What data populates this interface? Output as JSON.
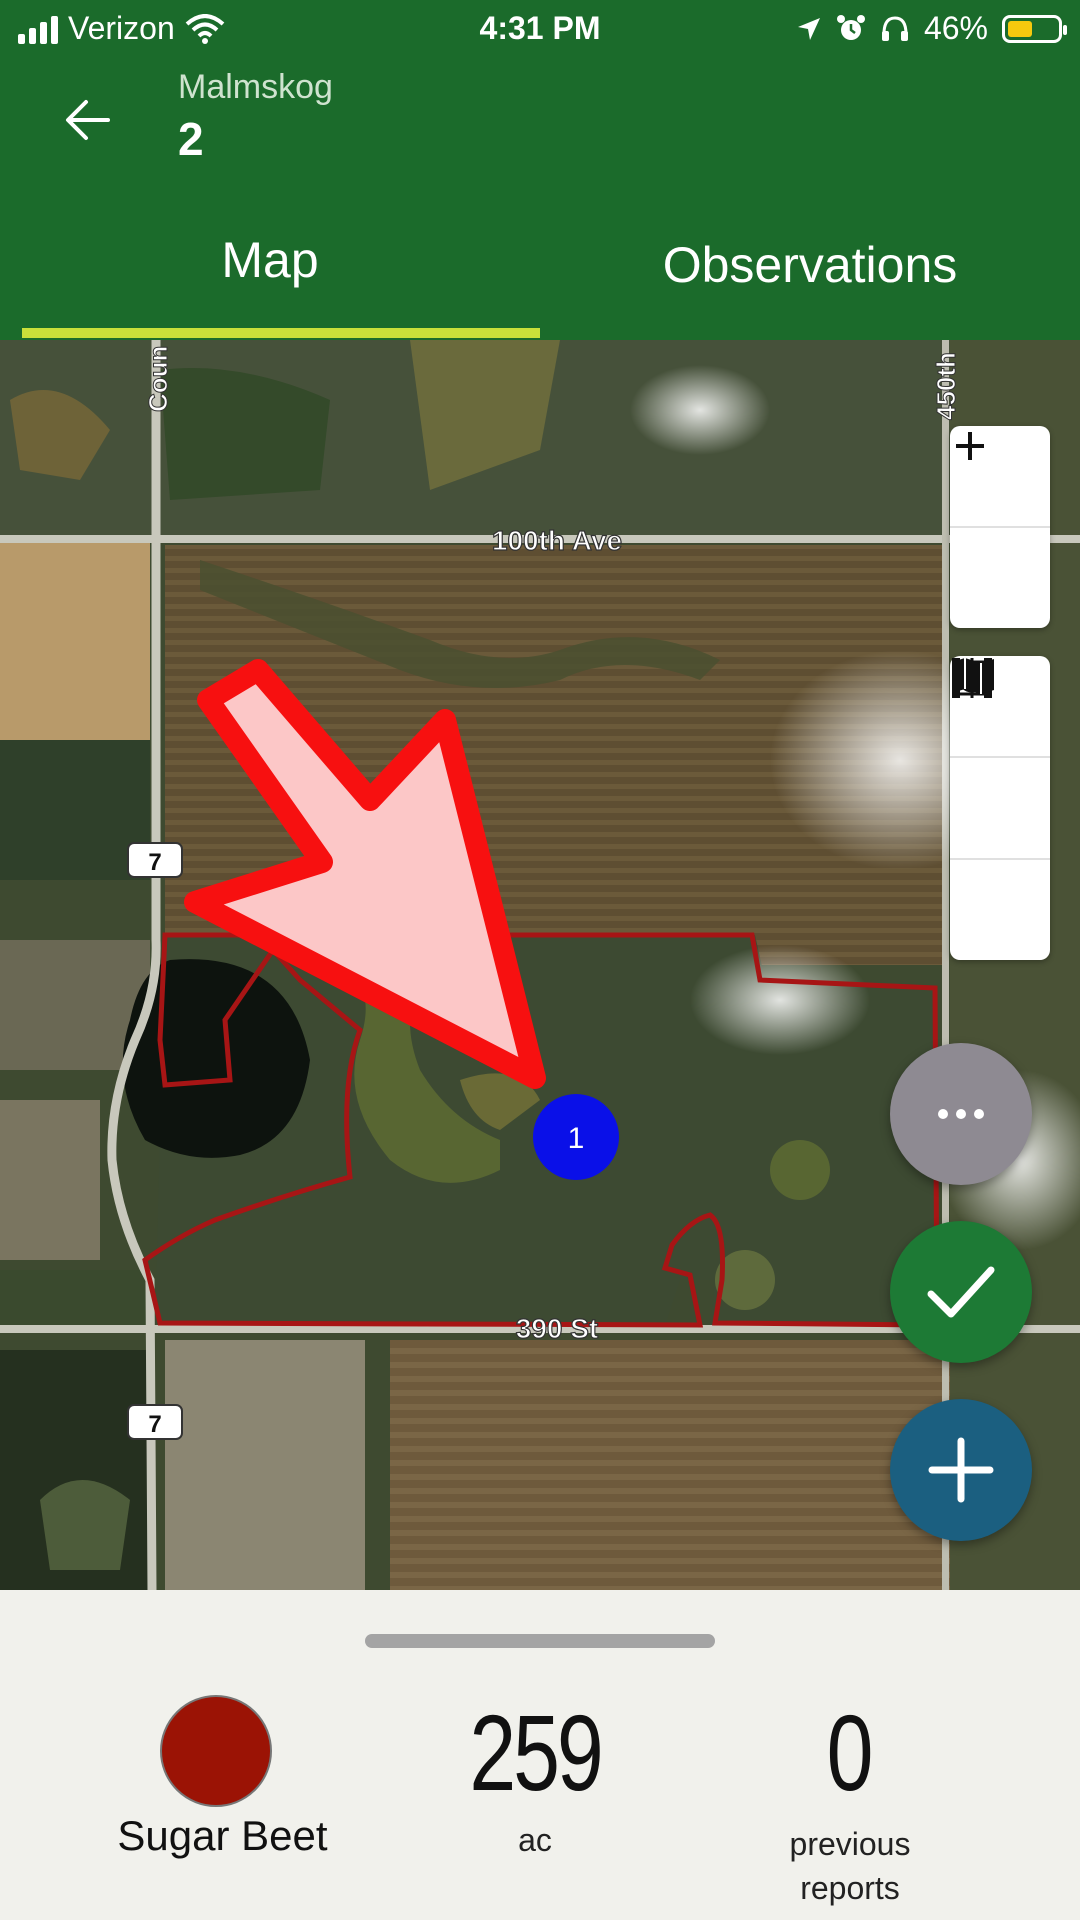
{
  "status_bar": {
    "carrier": "Verizon",
    "time": "4:31 PM",
    "battery_percent": "46%",
    "battery_level": 0.46,
    "icons": [
      "signal-icon",
      "wifi-icon",
      "location-arrow-icon",
      "alarm-icon",
      "headphones-icon",
      "battery-icon"
    ]
  },
  "header": {
    "back_icon": "arrow-left-icon",
    "field_group": "Malmskog",
    "field_name": "2"
  },
  "tabs": [
    {
      "label": "Map",
      "selected": true
    },
    {
      "label": "Observations",
      "selected": false
    }
  ],
  "colors": {
    "header_green": "#1b6b2b",
    "tab_indicator": "#c9e03a",
    "field_boundary": "#b31212",
    "marker_blue": "#0a10e8",
    "crop_color": "#9b1305",
    "fab_more": "#8e8a92",
    "fab_check": "#1d7a35",
    "fab_add": "#1b5f80"
  },
  "map": {
    "road_labels": [
      "100th Ave",
      "390 St",
      "Coun",
      "450th"
    ],
    "highway_shields": [
      "7",
      "7"
    ],
    "marker_label": "1",
    "annotation": "red-arrow-pointing-to-marker"
  },
  "map_controls": {
    "zoom": [
      "zoom-in-icon",
      "zoom-out-icon"
    ],
    "tools": [
      "locate-icon",
      "fit-bounds-icon",
      "map-layers-icon"
    ]
  },
  "fabs": [
    "more-icon",
    "check-icon",
    "plus-icon"
  ],
  "summary": {
    "crop_name": "Sugar Beet",
    "acres": "259",
    "acres_unit": "ac",
    "reports_count": "0",
    "reports_label_line1": "previous",
    "reports_label_line2": "reports"
  }
}
